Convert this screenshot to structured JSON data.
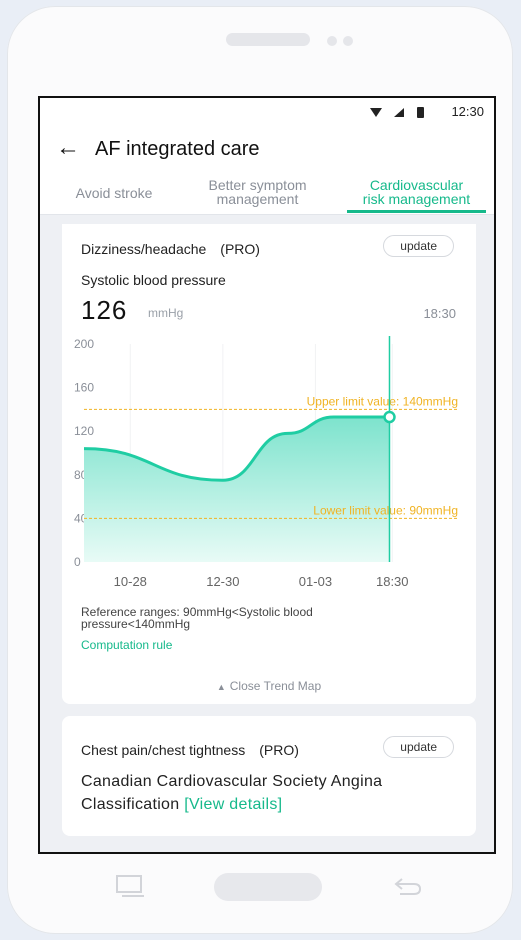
{
  "status_bar": {
    "time": "12:30"
  },
  "header": {
    "title": "AF integrated care"
  },
  "tabs": [
    {
      "label_line1": "Avoid stroke",
      "label_line2": ""
    },
    {
      "label_line1": "Better symptom",
      "label_line2": "management"
    },
    {
      "label_line1": "Cardiovascular",
      "label_line2": "risk management"
    }
  ],
  "card1": {
    "heading": "Dizziness/headache　(PRO)",
    "update_label": "update",
    "measure_label": "Systolic blood pressure",
    "value": "126",
    "unit": "mmHg",
    "time": "18:30",
    "upper_limit_label": "Upper limit value: 140mmHg",
    "lower_limit_label": "Lower limit value: 90mmHg",
    "reference_text": "Reference ranges:  90mmHg<Systolic blood pressure<140mmHg",
    "computation_rule": "Computation rule",
    "close_trend_map": "Close Trend Map"
  },
  "card2": {
    "heading": "Chest pain/chest tightness　(PRO)",
    "update_label": "update",
    "classification": "Canadian Cardiovascular Society Angina Classification",
    "view_details": "[View details]"
  },
  "chart_data": {
    "type": "area",
    "categories": [
      "10-28",
      "12-30",
      "01-03",
      "18:30"
    ],
    "x": [
      0,
      1.5,
      2.2,
      2.7,
      3.3
    ],
    "values": [
      104,
      75,
      118,
      133,
      133
    ],
    "ylim": [
      0,
      200
    ],
    "yticks": [
      0,
      40,
      80,
      120,
      160,
      200
    ],
    "upper_limit": 140,
    "lower_limit": 40,
    "selected_index": 4,
    "colors": {
      "line": "#1fcda3",
      "fill_top": "#7de3cd",
      "fill_bottom": "#e8fbf6",
      "limit": "#f0b323",
      "axis_text": "#8a8f98"
    }
  }
}
